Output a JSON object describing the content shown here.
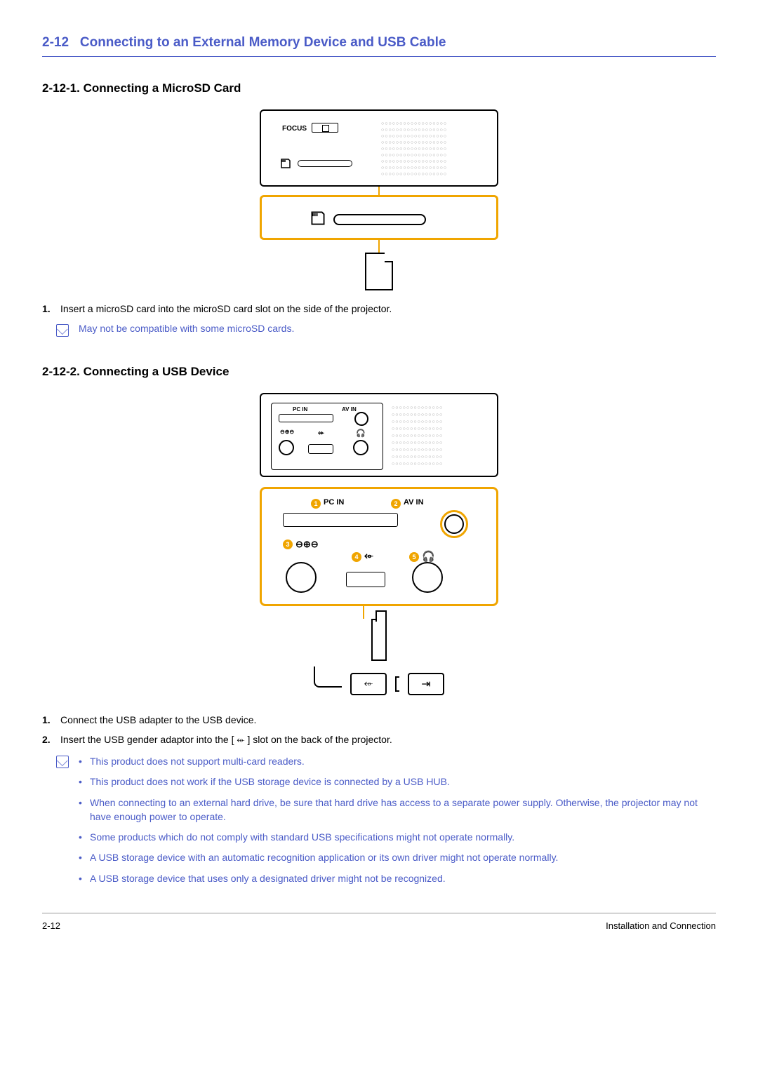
{
  "heading": {
    "number": "2-12",
    "title": "Connecting to an External Memory Device and USB Cable"
  },
  "section1": {
    "heading": "2-12-1. Connecting a MicroSD Card",
    "diagram": {
      "focus_label": "FOCUS"
    },
    "steps": [
      {
        "num": "1.",
        "text": "Insert a microSD card into the microSD card slot on the side of the projector."
      }
    ],
    "note": "May not be compatible with some microSD cards."
  },
  "section2": {
    "heading": "2-12-2. Connecting a USB Device",
    "diagram": {
      "pc_in": "PC IN",
      "av_in": "AV IN",
      "callouts": [
        "1",
        "2",
        "3",
        "4",
        "5"
      ]
    },
    "steps": [
      {
        "num": "1.",
        "text": "Connect the USB adapter to the USB device."
      },
      {
        "num": "2.",
        "text_before": "Insert the USB gender adaptor into the [ ",
        "text_after": " ] slot on the back of the projector."
      }
    ],
    "notes": [
      "This product does not support multi-card readers.",
      "This product does not work if the USB storage device is connected by a USB HUB.",
      "When connecting to an external hard drive, be sure that hard drive has access to a separate power supply. Otherwise, the projector may not have enough power to operate.",
      "Some products which do not comply with standard USB specifications might not operate normally.",
      "A USB storage device with an automatic recognition application or its own driver might not operate normally.",
      "A USB storage device that uses only a designated driver might not be recognized."
    ]
  },
  "footer": {
    "left": "2-12",
    "right": "Installation and Connection"
  }
}
